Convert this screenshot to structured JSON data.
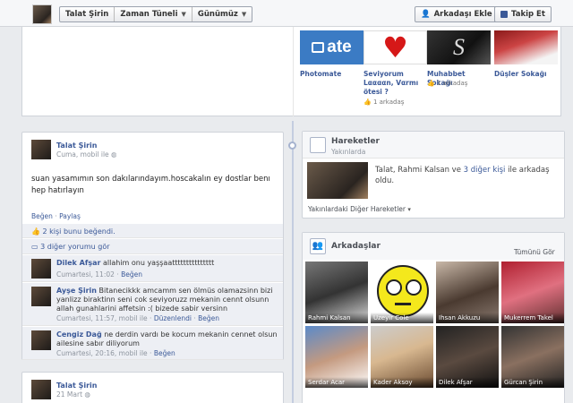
{
  "header": {
    "name": "Talat Şirin",
    "timeline": "Zaman Tüneli",
    "today": "Günümüz",
    "add_friend": "Arkadaşı Ekle",
    "follow": "Takip Et"
  },
  "cover": {
    "thumbs": [
      {
        "title": "Photomate",
        "logo": "ate",
        "sub": ""
      },
      {
        "title": "Seviyorum Lααααn, Vαrmı ötesi ?",
        "sub": "1 arkadaş"
      },
      {
        "title": "Muhabbet Sokağı",
        "sub": "1 arkadaş"
      },
      {
        "title": "Düşler Sokağı",
        "sub": ""
      }
    ]
  },
  "post": {
    "name": "Talat Şirin",
    "meta": "Cuma, mobil ile",
    "text": "suan yasamımın son dakılarındayım.hoscakalın ey dostlar benı hep hatırlayın",
    "like": "Beğen",
    "share": "Paylaş",
    "likes": "2 kişi bunu beğendi.",
    "more_comments": "3 diğer yorumu gör",
    "comments": [
      {
        "name": "Dilek Afşar",
        "text": "allahim onu yaşşaattttttttttttttt",
        "meta": "Cumartesi, 11:02",
        "like": "Beğen"
      },
      {
        "name": "Ayşe Şirin",
        "text": "Bitanecikkk amcamm sen ölmüs olamazsinn bizi yanlizz biraktinn seni cok seviyoruzz mekanin cennt olsunn allah gunahlarini affetsin :( bizede sabir versinn",
        "meta": "Cumartesi, 11:57, mobil ile",
        "edited": "Düzenlendi",
        "like": "Beğen"
      },
      {
        "name": "Cengiz Dağ",
        "text": "ne derdin vardı be kocum mekanin cennet olsun ailesine sabır diliyorum",
        "meta": "Cumartesi, 20:16, mobil ile",
        "like": "Beğen"
      }
    ]
  },
  "post2": {
    "name": "Talat Şirin",
    "meta": "21 Mart"
  },
  "activity": {
    "title": "Hareketler",
    "sub": "Yakınlarda",
    "text_pre": "Talat, Rahmi Kalsan ve ",
    "text_link": "3 diğer kişi",
    "text_post": " ile arkadaş oldu.",
    "footer": "Yakınlardaki Diğer Hareketler"
  },
  "friends": {
    "title": "Arkadaşlar",
    "see_all": "Tümünü Gör",
    "list": [
      {
        "name": "Rahmi Kalsan"
      },
      {
        "name": "Uzeyir Cole"
      },
      {
        "name": "Ihsan Akkuzu"
      },
      {
        "name": "Mukerrem Takel"
      },
      {
        "name": "Serdar Acar"
      },
      {
        "name": "Kader Aksoy"
      },
      {
        "name": "Dilek Afşar"
      },
      {
        "name": "Gürcan Şirin"
      }
    ]
  },
  "colors": {
    "link": "#3b5998",
    "bg": "#e9ebee"
  }
}
